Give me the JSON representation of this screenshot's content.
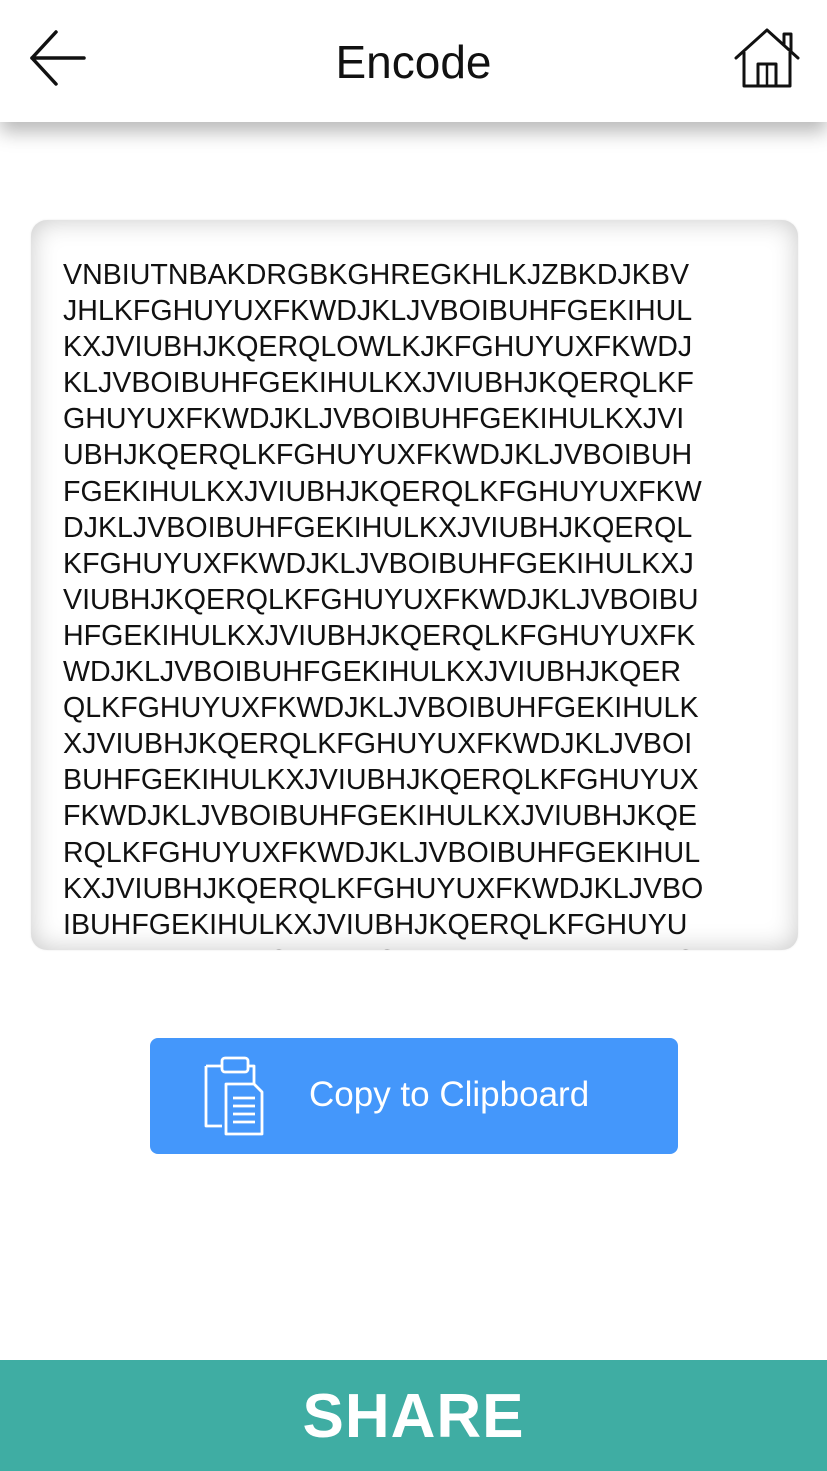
{
  "header": {
    "title": "Encode",
    "back_icon": "arrow-left-icon",
    "home_icon": "home-icon"
  },
  "encoded": {
    "text": "VNBIUTNBAKDRGBKGHREGKHLKJZBKDJKBV\nJHLKFGHUYUXFKWDJKLJVBOIBUHFGEKIHUL\nKXJVIUBHJKQERQLOWLKJKFGHUYUXFKWDJ\nKLJVBOIBUHFGEKIHULKXJVIUBHJKQERQLKF\nGHUYUXFKWDJKLJVBOIBUHFGEKIHULKXJVI\nUBHJKQERQLKFGHUYUXFKWDJKLJVBOIBUH\nFGEKIHULKXJVIUBHJKQERQLKFGHUYUXFKW\nDJKLJVBOIBUHFGEKIHULKXJVIUBHJKQERQL\nKFGHUYUXFKWDJKLJVBOIBUHFGEKIHULKXJ\nVIUBHJKQERQLKFGHUYUXFKWDJKLJVBOIBU\nHFGEKIHULKXJVIUBHJKQERQLKFGHUYUXFK\nWDJKLJVBOIBUHFGEKIHULKXJVIUBHJKQER\nQLKFGHUYUXFKWDJKLJVBOIBUHFGEKIHULK\nXJVIUBHJKQERQLKFGHUYUXFKWDJKLJVBOI\nBUHFGEKIHULKXJVIUBHJKQERQLKFGHUYUX\nFKWDJKLJVBOIBUHFGEKIHULKXJVIUBHJKQE\nRQLKFGHUYUXFKWDJKLJVBOIBUHFGEKIHUL\nKXJVIUBHJKQERQLKFGHUYUXFKWDJKLJVBO\nIBUHFGEKIHULKXJVIUBHJKQERQLKFGHUYU\nXFKWDJKLJVBOIBUHFGEKIHULKXJVIUBHJKQ"
  },
  "copy_button": {
    "label": "Copy to Clipboard",
    "icon": "clipboard-icon",
    "color": "#4497fb"
  },
  "share_button": {
    "label": "SHARE",
    "color": "#3fada3"
  }
}
